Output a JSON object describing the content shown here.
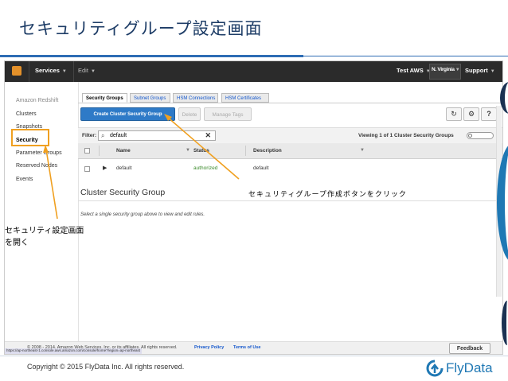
{
  "slide": {
    "title": "セキュリティグループ設定画面",
    "copyright": "Copyright © 2015 FlyData Inc. All rights reserved.",
    "brand": "FlyData",
    "accent_color": "#1f78b4",
    "highlight_color": "#f0a020"
  },
  "topbar": {
    "services_label": "Services",
    "edit_label": "Edit",
    "account_label": "Test AWS",
    "region_label": "N. Virginia",
    "support_label": "Support"
  },
  "sidebar": {
    "heading": "Amazon Redshift",
    "items": [
      {
        "label": "Clusters"
      },
      {
        "label": "Snapshots"
      },
      {
        "label": "Security"
      },
      {
        "label": "Parameter Groups"
      },
      {
        "label": "Reserved Nodes"
      },
      {
        "label": "Events"
      }
    ]
  },
  "tabs": [
    {
      "label": "Security Groups"
    },
    {
      "label": "Subnet Groups"
    },
    {
      "label": "HSM Connections"
    },
    {
      "label": "HSM Certificates"
    }
  ],
  "toolbar": {
    "create_label": "Create Cluster Security Group",
    "delete_label": "Delete",
    "manage_tags_label": "Manage Tags",
    "refresh_icon": "refresh-icon",
    "settings_icon": "gear-icon",
    "help_icon": "help-icon"
  },
  "filter": {
    "label": "Filter:",
    "value": "default",
    "viewing_text": "Viewing 1 of 1 Cluster Security Groups"
  },
  "table": {
    "columns": [
      "Name",
      "Status",
      "Description"
    ],
    "rows": [
      {
        "name": "default",
        "status": "authorized",
        "description": "default"
      }
    ]
  },
  "detail": {
    "title": "Cluster Security Group",
    "hint": "Select a single security group above to view and edit rules."
  },
  "footer": {
    "copyright": "© 2008 - 2014, Amazon Web Services, Inc. or its affiliates. All rights reserved.",
    "privacy_label": "Privacy Policy",
    "terms_label": "Terms of Use",
    "feedback_label": "Feedback",
    "status_url": "https://ap-northeast-1.console.aws.amazon.com/console/home?region=ap-northeast"
  },
  "annotations": {
    "create_button_note": "セキュリティグループ作成ボタンをクリック",
    "security_note_line1": "セキュリティ設定画面",
    "security_note_line2": "を開く"
  }
}
